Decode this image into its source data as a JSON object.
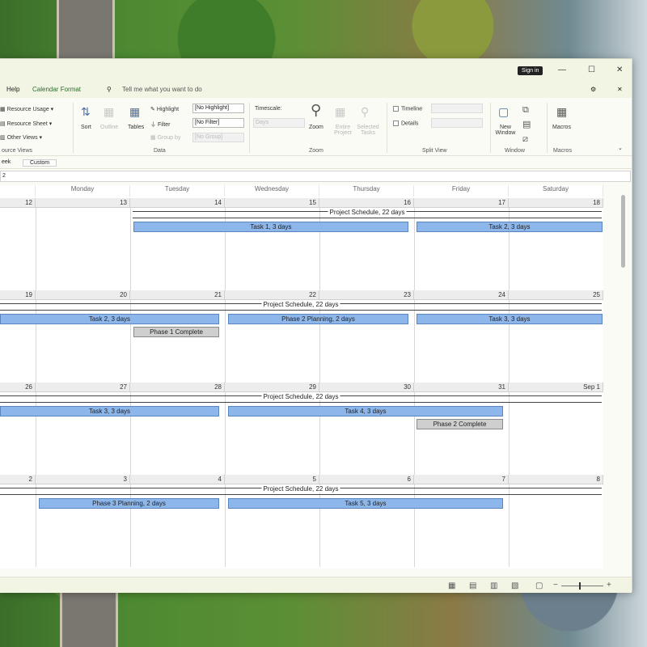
{
  "titlebar": {
    "signin": "Sign in",
    "min": "—",
    "max": "☐",
    "close": "✕"
  },
  "menubar": {
    "help": "Help",
    "calendar_format": "Calendar Format",
    "search": "Tell me what you want to do",
    "settings": "⚙",
    "close": "✕"
  },
  "ribbon": {
    "resource_usage": "Resource Usage",
    "resource_sheet": "Resource Sheet",
    "other_views": "Other Views",
    "resource_views": "ource Views",
    "sort": "Sort",
    "outline": "Outline",
    "tables": "Tables",
    "highlight": "Highlight",
    "highlight_value": "[No Highlight]",
    "filter": "Filter",
    "filter_value": "[No Filter]",
    "group_by": "Group by",
    "group_value": "[No Group]",
    "data_group": "Data",
    "timescale": "Timescale:",
    "timescale_value": "Days",
    "zoom": "Zoom",
    "entire_project": "Entire Project",
    "selected_tasks": "Selected Tasks",
    "zoom_group": "Zoom",
    "timeline": "Timeline",
    "details": "Details",
    "split_group": "Split View",
    "new_window": "New Window",
    "window_group": "Window",
    "macros": "Macros",
    "macros_group": "Macros"
  },
  "viewtabs": {
    "tab1": "eek",
    "tab2": "Custom"
  },
  "datebar": {
    "text": "2"
  },
  "calendar": {
    "day_names": [
      "",
      "Monday",
      "Tuesday",
      "Wednesday",
      "Thursday",
      "Friday",
      "Saturday"
    ],
    "weeks": [
      {
        "dates": [
          "12",
          "13",
          "14",
          "15",
          "16",
          "17",
          "18"
        ]
      },
      {
        "dates": [
          "19",
          "20",
          "21",
          "22",
          "23",
          "24",
          "25"
        ]
      },
      {
        "dates": [
          "26",
          "27",
          "28",
          "29",
          "30",
          "31",
          "Sep 1"
        ]
      },
      {
        "dates": [
          "2",
          "3",
          "4",
          "5",
          "6",
          "7",
          "8"
        ]
      }
    ],
    "summary": "Project Schedule, 22 days",
    "tasks": {
      "w1a": "Task 1, 3 days",
      "w1b": "Task 2, 3 days",
      "w2a": "Task 2, 3 days",
      "w2m": "Phase 1 Complete",
      "w2b": "Phase 2 Planning, 2 days",
      "w2c": "Task 3, 3 days",
      "w3a": "Task 3, 3 days",
      "w3b": "Task 4, 3 days",
      "w3m": "Phase 2 Complete",
      "w4a": "Phase  3 Planning, 2 days",
      "w4b": "Task 5, 3 days"
    }
  },
  "colors": {
    "task_bar": "#8db6ea",
    "milestone_bar": "#cfcfcf",
    "titlebar": "#f3f5e4"
  }
}
